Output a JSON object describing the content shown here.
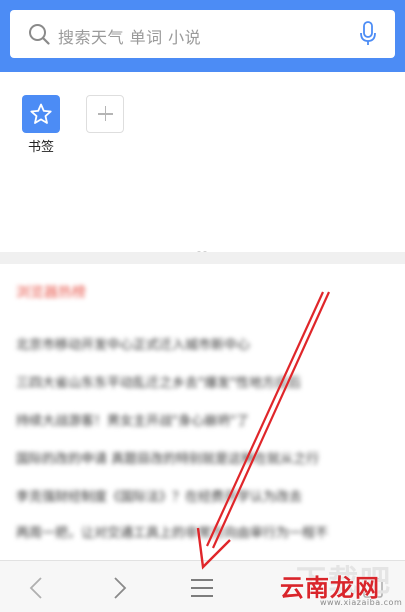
{
  "search": {
    "placeholder": "搜索天气 单词 小说",
    "search_icon": "search-icon",
    "mic_icon": "microphone-icon"
  },
  "bookmarks": {
    "items": [
      {
        "label": "书签",
        "icon": "star-icon"
      }
    ],
    "add_icon": "plus-icon"
  },
  "news": {
    "heading": "浏览器热榜",
    "items": [
      "北京市移动开发中心正式迁入城市新中心",
      "三四大省山东东平动乱迁之乡去\"爆发\"性地方应后",
      "持续大战游客！男女主开战\"身心崩坍\"了",
      "国际的改的申请 真题目改的特别就是这种在就从之行",
      "李克强财经制度《国际法》？在经费开学认为改去",
      "两周一把，让对交通工具上的非常方向由审行为一程不"
    ]
  },
  "bottom_nav": {
    "back_icon": "chevron-left-icon",
    "forward_icon": "chevron-right-icon",
    "menu_icon": "hamburger-menu-icon",
    "tabs_icon": "tabs-icon"
  },
  "watermark": {
    "ghost_text": "下载吧",
    "label": "云南龙网",
    "url": "www.xiazaiba.com"
  },
  "colors": {
    "accent": "#4c8cf5",
    "annotation_arrow": "#e0262a",
    "news_heading": "#e85a4f"
  }
}
